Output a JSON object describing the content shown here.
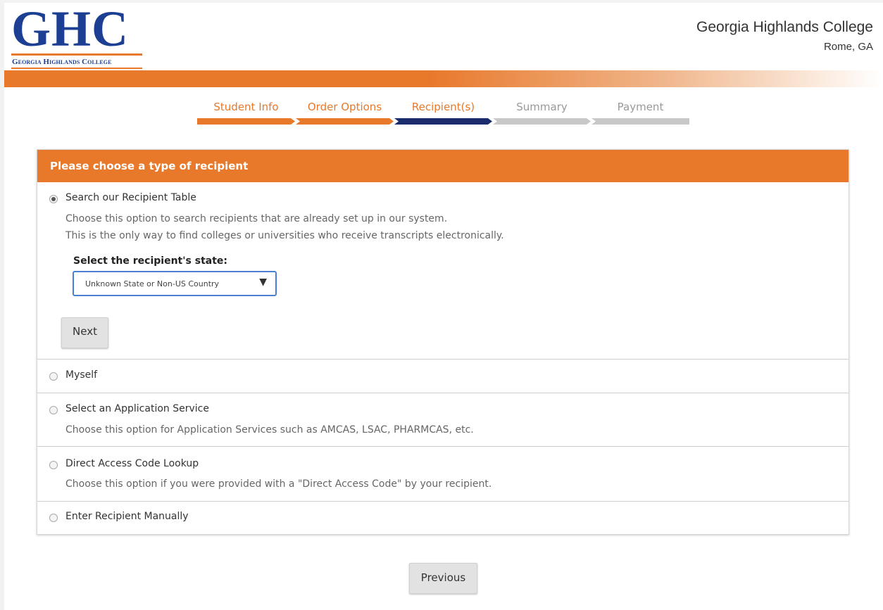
{
  "header": {
    "logo_letters": "GHC",
    "logo_subtitle": "Georgia Highlands College",
    "college_name": "Georgia Highlands College",
    "college_city": "Rome, GA"
  },
  "steps": [
    {
      "label": "Student Info",
      "state": "done"
    },
    {
      "label": "Order Options",
      "state": "done"
    },
    {
      "label": "Recipient(s)",
      "state": "active"
    },
    {
      "label": "Summary",
      "state": "todo"
    },
    {
      "label": "Payment",
      "state": "todo"
    }
  ],
  "panel": {
    "title": "Please choose a type of recipient",
    "options": [
      {
        "label": "Search our Recipient Table",
        "selected": true,
        "desc": [
          "Choose this option to search recipients that are already set up in our system.",
          "This is the only way to find colleges or universities who receive transcripts electronically."
        ]
      },
      {
        "label": "Myself",
        "selected": false
      },
      {
        "label": "Select an Application Service",
        "selected": false,
        "desc": [
          "Choose this option for Application Services such as AMCAS, LSAC, PHARMCAS, etc."
        ]
      },
      {
        "label": "Direct Access Code Lookup",
        "selected": false,
        "desc": [
          "Choose this option if you were provided with a \"Direct Access Code\" by your recipient."
        ]
      },
      {
        "label": "Enter Recipient Manually",
        "selected": false
      }
    ],
    "state_field_label": "Select the recipient's state:",
    "state_select_value": "Unknown State or Non-US Country",
    "next_label": "Next"
  },
  "previous_label": "Previous",
  "colors": {
    "brand_orange": "#e8782a",
    "brand_navy": "#1c3f94",
    "step_active": "#1a2c6b",
    "step_todo": "#c8c8c8"
  }
}
